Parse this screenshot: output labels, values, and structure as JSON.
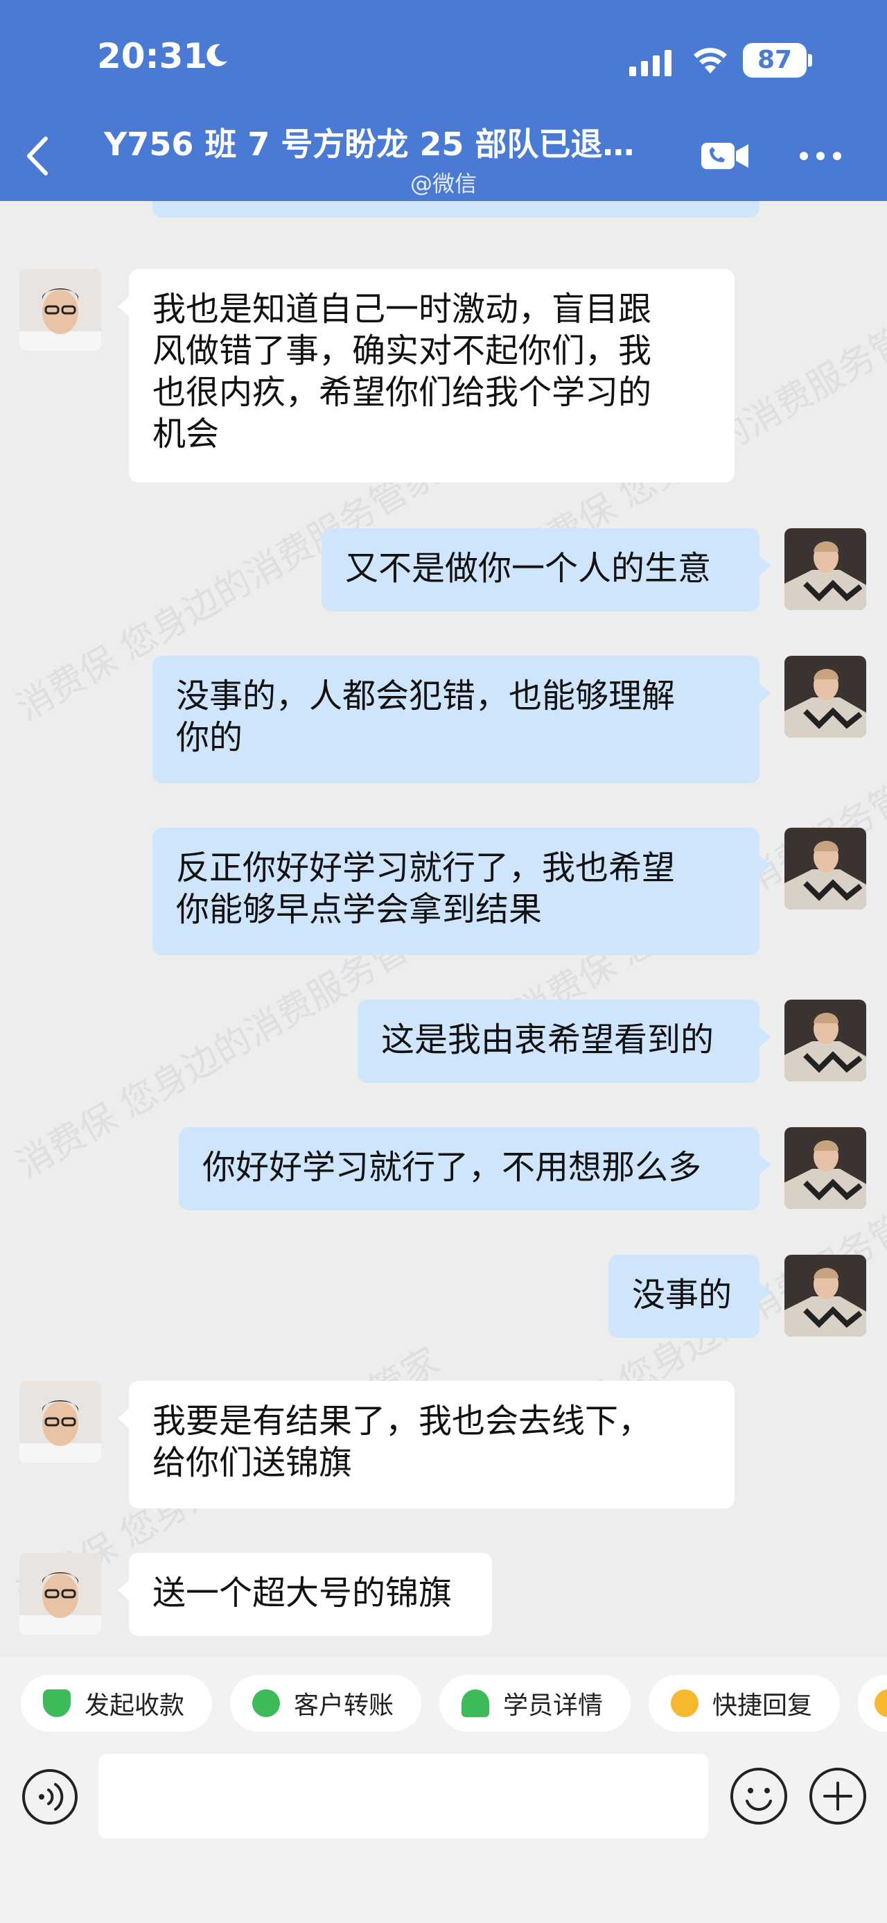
{
  "status_bar": {
    "time": "20:31",
    "battery": "87"
  },
  "header": {
    "title": "Y756 班 7 号方盼龙 25 部队已退…",
    "subtitle": "@微信"
  },
  "messages": [
    {
      "side": "in",
      "text": "我也是知道自己一时激动，盲目跟\n风做错了事，确实对不起你们，我\n也很内疚，希望你们给我个学习的\n机会"
    },
    {
      "side": "out",
      "text": "又不是做你一个人的生意"
    },
    {
      "side": "out",
      "text": "没事的，人都会犯错，也能够理解\n你的"
    },
    {
      "side": "out",
      "text": "反正你好好学习就行了，我也希望\n你能够早点学会拿到结果"
    },
    {
      "side": "out",
      "text": "这是我由衷希望看到的"
    },
    {
      "side": "out",
      "text": "你好好学习就行了，不用想那么多"
    },
    {
      "side": "out",
      "text": "没事的"
    },
    {
      "side": "in",
      "text": "我要是有结果了，我也会去线下，\n给你们送锦旗"
    },
    {
      "side": "in",
      "text": "送一个超大号的锦旗"
    }
  ],
  "quick_actions": [
    {
      "label": "发起收款",
      "icon": "yuan-shield-icon",
      "color": "#3dbb5b"
    },
    {
      "label": "客户转账",
      "icon": "transfer-icon",
      "color": "#3dbb5b"
    },
    {
      "label": "学员详情",
      "icon": "student-icon",
      "color": "#3dbb5b"
    },
    {
      "label": "快捷回复",
      "icon": "quick-reply-icon",
      "color": "#f5b82e"
    }
  ],
  "watermark_text": "消费保 您身边的消费服务管家",
  "colors": {
    "header": "#4a7ad3",
    "outgoing_bubble": "#cfe5fc",
    "incoming_bubble": "#ffffff",
    "background": "#ededed"
  }
}
